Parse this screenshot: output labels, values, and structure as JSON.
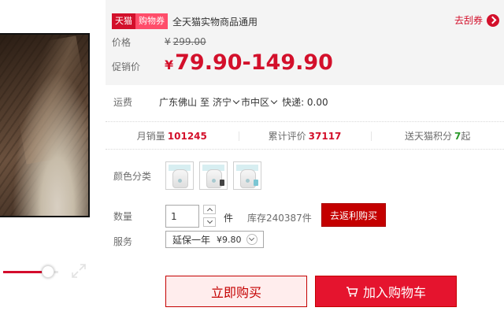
{
  "colors": {
    "accent": "#d3102b",
    "buy_bg": "#ffeded",
    "cart_bg": "#e5142e",
    "green": "#2c9a2c"
  },
  "media": {
    "video_progress": 0.8,
    "fullscreen_icon": "expand-icon"
  },
  "coupon": {
    "tag_tmall": "天猫",
    "tag_coupon": "购物券",
    "desc": "全天猫实物商品通用",
    "link_label": "去刮券"
  },
  "price": {
    "orig_label": "价格",
    "orig_currency": "¥",
    "orig_value": "299.00",
    "promo_label": "促销价",
    "promo_currency": "¥",
    "promo_value": "79.90-149.90"
  },
  "shipping": {
    "label": "运费",
    "from": "广东佛山",
    "to_word": "至",
    "city": "济宁",
    "district": "市中区",
    "express": "快递: 0.00"
  },
  "stats": {
    "monthly_sales_label": "月销量",
    "monthly_sales_value": "101245",
    "reviews_label": "累计评价",
    "reviews_value": "37117",
    "points_label": "送天猫积分",
    "points_value": "7",
    "points_suffix": "起"
  },
  "options": {
    "color_label": "颜色分类",
    "swatch_count": 3
  },
  "quantity": {
    "label": "数量",
    "value": "1",
    "unit": "件",
    "stock": "库存240387件",
    "rebate_button": "去返利购买"
  },
  "service": {
    "label": "服务",
    "selected_name": "延保一年",
    "selected_price": "¥9.80"
  },
  "actions": {
    "buy_now": "立即购买",
    "add_cart": "加入购物车"
  }
}
